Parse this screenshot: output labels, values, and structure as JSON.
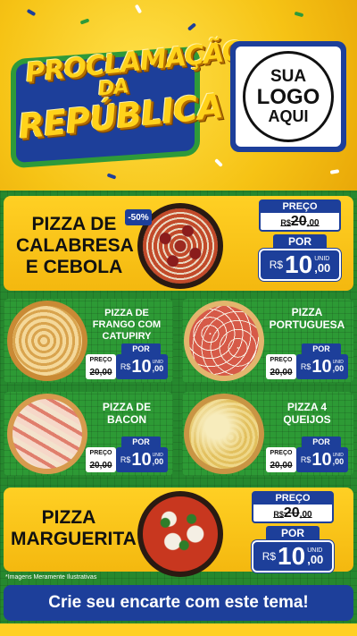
{
  "header": {
    "title_line1": "PROCLAMAÇÃO",
    "title_line2": "DA",
    "title_line3": "REPÚBLICA",
    "logo_line1": "SUA",
    "logo_line2": "LOGO",
    "logo_line3": "AQUI"
  },
  "labels": {
    "preco": "PREÇO",
    "por": "POR",
    "unid": "UNID",
    "currency": "R$",
    "discount_badge": "-50%"
  },
  "products": [
    {
      "name": "PIZZA DE CALABRESA E CEBOLA",
      "old_int": "20",
      "old_cents": ",00",
      "new_int": "10",
      "new_cents": ",00"
    },
    {
      "name": "PIZZA DE FRANGO COM CATUPIRY",
      "old_price": "20,00",
      "new_int": "10",
      "new_cents": ",00"
    },
    {
      "name": "PIZZA PORTUGUESA",
      "old_price": "20,00",
      "new_int": "10",
      "new_cents": ",00"
    },
    {
      "name": "PIZZA DE BACON",
      "old_price": "20,00",
      "new_int": "10",
      "new_cents": ",00"
    },
    {
      "name": "PIZZA 4 QUEIJOS",
      "old_price": "20,00",
      "new_int": "10",
      "new_cents": ",00"
    },
    {
      "name": "PIZZA MARGUERITA",
      "old_int": "20",
      "old_cents": ",00",
      "new_int": "10",
      "new_cents": ",00"
    }
  ],
  "disclaimer": "*Imagens Meramente Ilustrativas",
  "footer": "Crie seu encarte com este tema!",
  "colors": {
    "brand_yellow": "#ffd024",
    "brand_blue": "#1d3f9a",
    "brand_green": "#2d9a35"
  }
}
